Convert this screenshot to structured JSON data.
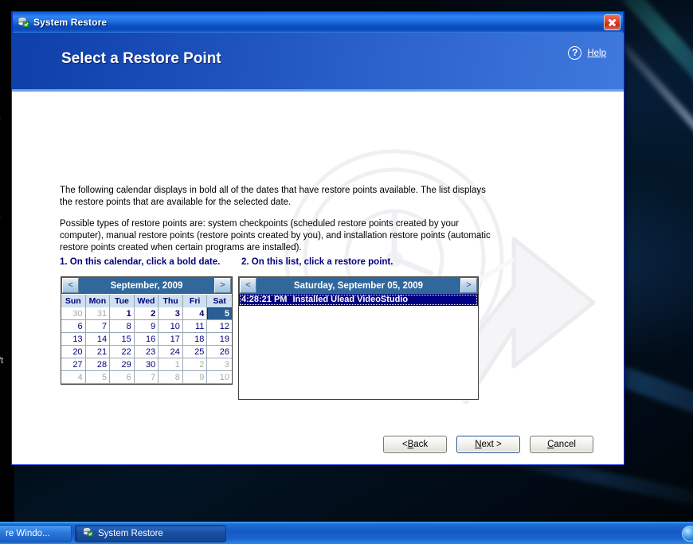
{
  "window": {
    "title": "System Restore",
    "app_icon": "system-restore-icon",
    "close_label": "×"
  },
  "banner": {
    "heading": "Select a Restore Point",
    "help_label": "Help",
    "help_icon": "question-mark-icon"
  },
  "body": {
    "paragraph1": "The following calendar displays in bold all of the dates that have restore points available. The list displays the restore points that are available for the selected date.",
    "paragraph2": "Possible types of restore points are: system checkpoints (scheduled restore points created by your computer), manual restore points (restore points created by you), and installation restore points (automatic restore points created when certain programs are installed).",
    "step1": "1. On this calendar, click a bold date.",
    "step2": "2. On this list, click a restore point."
  },
  "calendar": {
    "month_title": "September, 2009",
    "prev_label": "<",
    "next_label": ">",
    "day_headers": [
      "Sun",
      "Mon",
      "Tue",
      "Wed",
      "Thu",
      "Fri",
      "Sat"
    ],
    "weeks": [
      [
        {
          "n": "30",
          "type": "other"
        },
        {
          "n": "31",
          "type": "other"
        },
        {
          "n": "1",
          "type": "bold"
        },
        {
          "n": "2",
          "type": "bold"
        },
        {
          "n": "3",
          "type": "bold"
        },
        {
          "n": "4",
          "type": "bold"
        },
        {
          "n": "5",
          "type": "selected"
        }
      ],
      [
        {
          "n": "6",
          "type": "normal"
        },
        {
          "n": "7",
          "type": "normal"
        },
        {
          "n": "8",
          "type": "normal"
        },
        {
          "n": "9",
          "type": "normal"
        },
        {
          "n": "10",
          "type": "normal"
        },
        {
          "n": "11",
          "type": "normal"
        },
        {
          "n": "12",
          "type": "normal"
        }
      ],
      [
        {
          "n": "13",
          "type": "normal"
        },
        {
          "n": "14",
          "type": "normal"
        },
        {
          "n": "15",
          "type": "normal"
        },
        {
          "n": "16",
          "type": "normal"
        },
        {
          "n": "17",
          "type": "normal"
        },
        {
          "n": "18",
          "type": "normal"
        },
        {
          "n": "19",
          "type": "normal"
        }
      ],
      [
        {
          "n": "20",
          "type": "normal"
        },
        {
          "n": "21",
          "type": "normal"
        },
        {
          "n": "22",
          "type": "normal"
        },
        {
          "n": "23",
          "type": "normal"
        },
        {
          "n": "24",
          "type": "normal"
        },
        {
          "n": "25",
          "type": "normal"
        },
        {
          "n": "26",
          "type": "normal"
        }
      ],
      [
        {
          "n": "27",
          "type": "normal"
        },
        {
          "n": "28",
          "type": "normal"
        },
        {
          "n": "29",
          "type": "normal"
        },
        {
          "n": "30",
          "type": "normal"
        },
        {
          "n": "1",
          "type": "other"
        },
        {
          "n": "2",
          "type": "other"
        },
        {
          "n": "3",
          "type": "other"
        }
      ],
      [
        {
          "n": "4",
          "type": "other"
        },
        {
          "n": "5",
          "type": "other"
        },
        {
          "n": "6",
          "type": "other"
        },
        {
          "n": "7",
          "type": "other"
        },
        {
          "n": "8",
          "type": "other"
        },
        {
          "n": "9",
          "type": "other"
        },
        {
          "n": "10",
          "type": "other"
        }
      ]
    ]
  },
  "restore_points": {
    "header_date": "Saturday, September 05, 2009",
    "prev_label": "<",
    "next_label": ">",
    "items": [
      {
        "time": "4:28:21 PM",
        "description": "Installed Ulead VideoStudio",
        "selected": true
      }
    ]
  },
  "buttons": {
    "back": {
      "pre": "< ",
      "accel": "B",
      "post": "ack"
    },
    "next": {
      "pre": "",
      "accel": "N",
      "post": "ext >"
    },
    "cancel": {
      "pre": "",
      "accel": "C",
      "post": "ancel"
    }
  },
  "taskbar": {
    "buttons": [
      {
        "label": "re Windo...",
        "icon": "window-icon",
        "active": false
      },
      {
        "label": "System Restore",
        "icon": "system-restore-icon",
        "active": true
      }
    ],
    "tray_icon": "blue-circle-icon"
  },
  "background_window": {
    "fragments": [
      "y",
      "...",
      "...",
      "-",
      "oft",
      "o"
    ]
  },
  "colors": {
    "title_bar_blue": "#1a6ae8",
    "banner_blue": "#2c63cc",
    "accent_navy": "#00007a",
    "selection_navy": "#000080",
    "calendar_header": "#31689c",
    "close_red": "#e0402a"
  }
}
